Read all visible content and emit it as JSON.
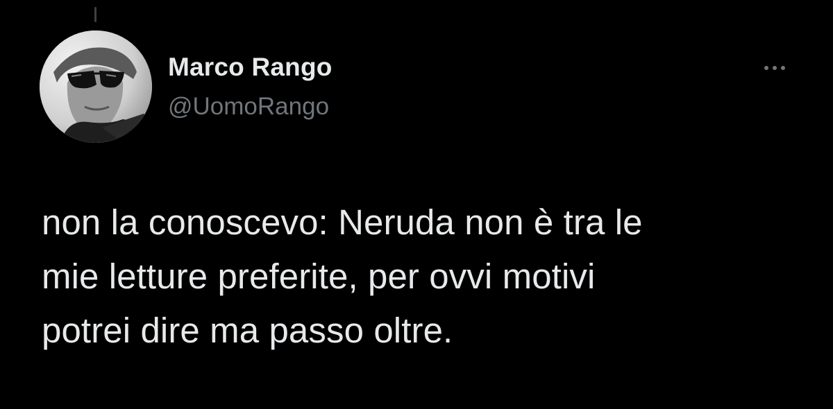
{
  "tweet": {
    "author": {
      "display_name": "Marco Rango",
      "handle": "@UomoRango",
      "avatar_icon": "profile-photo"
    },
    "more_icon": "ellipsis-horizontal-icon",
    "text": "non la conoscevo: Neruda non è tra le\nmie letture preferite, per ovvi motivi\npotrei dire ma passo oltre."
  },
  "colors": {
    "background": "#000000",
    "primary_text": "#e7e9ea",
    "secondary_text": "#71767b",
    "thread_line": "#3e4144"
  }
}
